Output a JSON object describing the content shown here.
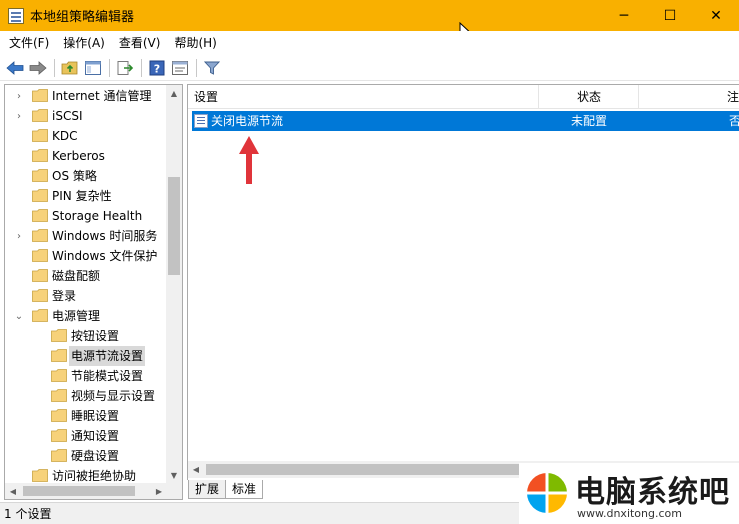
{
  "window": {
    "title": "本地组策略编辑器",
    "controls": {
      "minimize": "─",
      "maximize": "☐",
      "close": "✕"
    }
  },
  "menu": [
    {
      "label": "文件(F)"
    },
    {
      "label": "操作(A)"
    },
    {
      "label": "查看(V)"
    },
    {
      "label": "帮助(H)"
    }
  ],
  "toolbar": {
    "icons": [
      "back-arrow-icon",
      "forward-arrow-icon",
      "up-folder-icon",
      "show-hide-tree-icon",
      "export-list-icon",
      "help-icon",
      "properties-icon",
      "filter-icon"
    ]
  },
  "tree": {
    "items": [
      {
        "label": "Internet 通信管理",
        "level": 0,
        "expander": "›"
      },
      {
        "label": "iSCSI",
        "level": 0,
        "expander": "›"
      },
      {
        "label": "KDC",
        "level": 0,
        "expander": ""
      },
      {
        "label": "Kerberos",
        "level": 0,
        "expander": ""
      },
      {
        "label": "OS 策略",
        "level": 0,
        "expander": ""
      },
      {
        "label": "PIN 复杂性",
        "level": 0,
        "expander": ""
      },
      {
        "label": "Storage Health",
        "level": 0,
        "expander": ""
      },
      {
        "label": "Windows 时间服务",
        "level": 0,
        "expander": "›"
      },
      {
        "label": "Windows 文件保护",
        "level": 0,
        "expander": ""
      },
      {
        "label": "磁盘配额",
        "level": 0,
        "expander": ""
      },
      {
        "label": "登录",
        "level": 0,
        "expander": ""
      },
      {
        "label": "电源管理",
        "level": 0,
        "expander": "⌄"
      },
      {
        "label": "按钮设置",
        "level": 1,
        "expander": ""
      },
      {
        "label": "电源节流设置",
        "level": 1,
        "expander": "",
        "selected": true
      },
      {
        "label": "节能模式设置",
        "level": 1,
        "expander": ""
      },
      {
        "label": "视频与显示设置",
        "level": 1,
        "expander": ""
      },
      {
        "label": "睡眠设置",
        "level": 1,
        "expander": ""
      },
      {
        "label": "通知设置",
        "level": 1,
        "expander": ""
      },
      {
        "label": "硬盘设置",
        "level": 1,
        "expander": ""
      },
      {
        "label": "访问被拒绝协助",
        "level": 0,
        "expander": ""
      }
    ]
  },
  "list": {
    "columns": [
      {
        "label": "设置"
      },
      {
        "label": "状态"
      },
      {
        "label": "注"
      }
    ],
    "rows": [
      {
        "name": "关闭电源节流",
        "state": "未配置",
        "note": "否"
      }
    ]
  },
  "tabs": [
    {
      "label": "扩展"
    },
    {
      "label": "标准"
    }
  ],
  "status": {
    "text": "1 个设置"
  },
  "watermark": {
    "title": "电脑系统吧",
    "url": "www.dnxitong.com"
  },
  "colors": {
    "titlebar": "#f9b000",
    "selection": "#0078d7",
    "annotation_arrow": "#e0343a"
  }
}
